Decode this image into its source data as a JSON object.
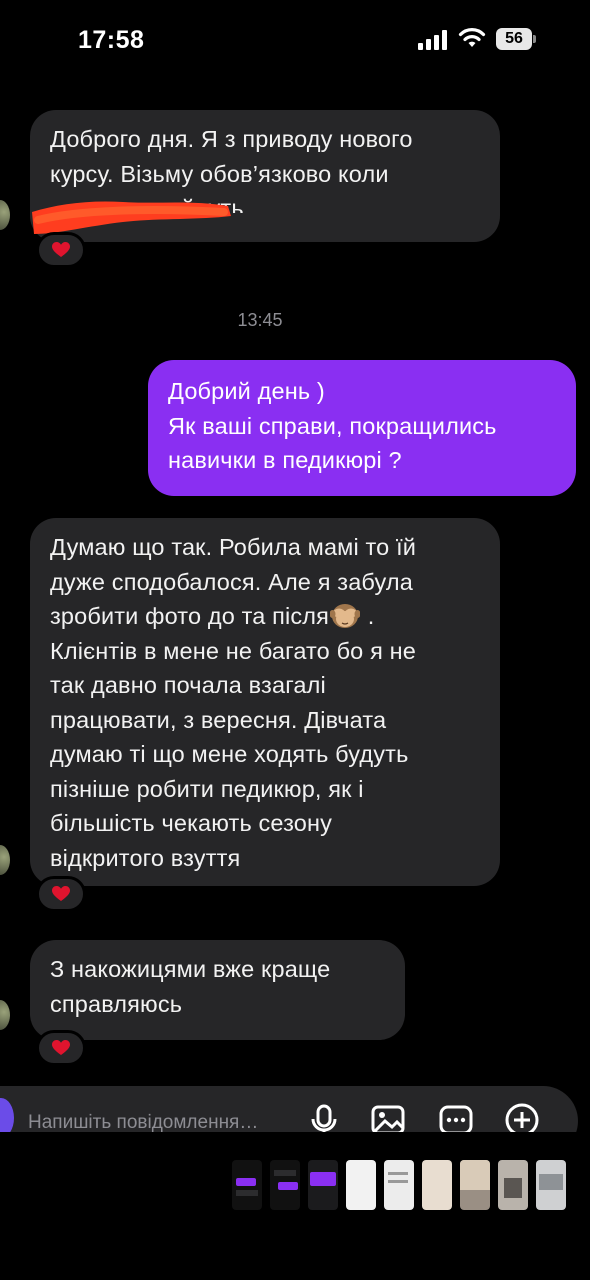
{
  "status": {
    "time": "17:58",
    "battery": "56"
  },
  "messages": [
    {
      "id": "m1",
      "direction": "incoming",
      "lines": [
        "Доброго дня. Я з приводу нового",
        "курсу. Візьму обов’язково коли",
        "прийдуть"
      ],
      "reaction": "heart"
    },
    {
      "id": "ts",
      "type": "timestamp",
      "text": "13:45"
    },
    {
      "id": "m2",
      "direction": "outgoing",
      "lines": [
        "Добрий день )",
        "Як ваші справи, покращились",
        "навички в педикюрі ?"
      ]
    },
    {
      "id": "m3",
      "direction": "incoming",
      "lines": [
        "Думаю що так. Робила мамі то їй",
        "дуже сподобалося. Але я забула",
        "зробити фото до та після",
        "Клієнтів в мене не багато бо я не",
        "так давно почала взагалі",
        "працювати, з вересня. Дівчата",
        "думаю ті що мене ходять будуть",
        "пізніше робити педикюр, як і",
        "більшість чекають сезону",
        "відкритого взуття"
      ],
      "line3_suffix": " .",
      "reaction": "heart"
    },
    {
      "id": "m4",
      "direction": "incoming",
      "lines": [
        "З накожицями вже краще",
        "справляюсь"
      ],
      "reaction": "heart"
    }
  ],
  "composer": {
    "placeholder": "Напишіть повідомлення…",
    "icons": [
      "microphone-icon",
      "image-icon",
      "sticker-icon",
      "plus-icon"
    ]
  },
  "colors": {
    "background": "#000000",
    "incoming_bubble": "#262628",
    "outgoing_bubble": "#8a2ff2",
    "timestamp": "#8d8d93",
    "redaction": "#ff3d1f"
  }
}
